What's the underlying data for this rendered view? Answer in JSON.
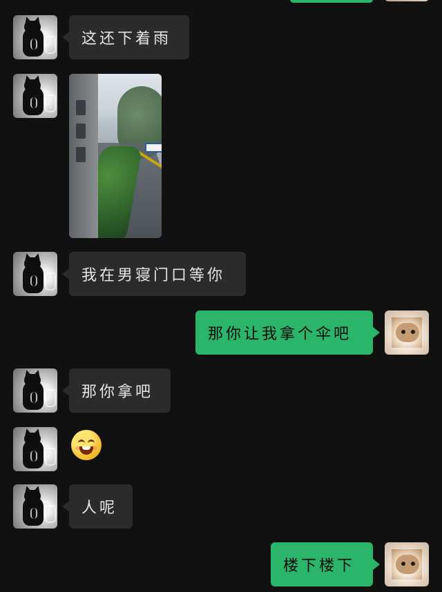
{
  "messages": [
    {
      "side": "left",
      "type": "text",
      "text": "这还下着雨"
    },
    {
      "side": "left",
      "type": "image",
      "image": "rainy-street-photo"
    },
    {
      "side": "left",
      "type": "text",
      "text": "我在男寝门口等你"
    },
    {
      "side": "right",
      "type": "text",
      "text": "那你让我拿个伞吧"
    },
    {
      "side": "left",
      "type": "text",
      "text": "那你拿吧"
    },
    {
      "side": "left",
      "type": "emoji",
      "emoji": "grinning-face-emoji"
    },
    {
      "side": "left",
      "type": "text",
      "text": "人呢"
    },
    {
      "side": "right",
      "type": "text",
      "text": "楼下楼下"
    }
  ],
  "colors": {
    "background": "#111111",
    "incoming_bubble": "#2b2b2b",
    "outgoing_bubble": "#2bb56b",
    "incoming_text": "#e6e6e6",
    "outgoing_text": "#0b0b0b"
  },
  "icons": {
    "left_avatar": "black-cat-avatar",
    "right_avatar": "kitten-avatar"
  }
}
